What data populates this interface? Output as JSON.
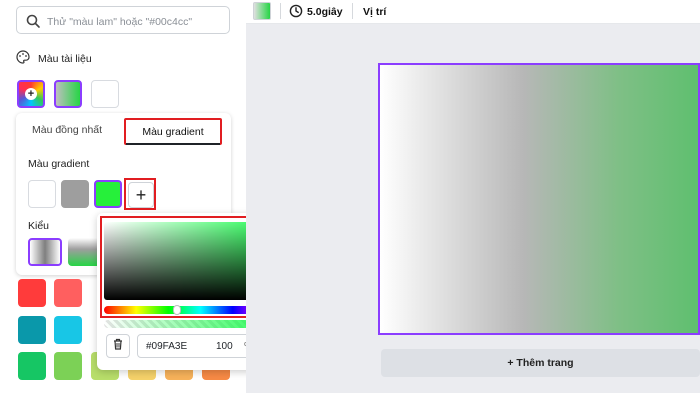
{
  "search": {
    "placeholder": "Thử \"màu lam\" hoặc \"#00c4cc\""
  },
  "document_colors": {
    "label": "Màu tài liệu",
    "add_icon_text": "+"
  },
  "tabs": {
    "solid": "Màu đồng nhất",
    "gradient": "Màu gradient"
  },
  "gradient_section": {
    "label": "Màu gradient",
    "stops": [
      "#ffffff",
      "#9e9e9e",
      "#26f03a"
    ],
    "add_text": "+"
  },
  "style_section": {
    "label": "Kiểu"
  },
  "palette_rows": [
    [
      "#ff3b3b",
      "#ff5f5f",
      "#ff8a8a",
      "#ff8a8a",
      "#ff8a8a",
      "#ff8a8a",
      "#ff8a8a"
    ],
    [
      "#0a98aa",
      "#18c6e6",
      "#31d1ea",
      "#31d1ea",
      "#31d1ea",
      "#31d1ea",
      "#31d1ea"
    ],
    [
      "#16c664",
      "#7cd156",
      "#b8de6a",
      "#f5d26a",
      "#f7b25a",
      "#f78a45",
      "#f78a45"
    ]
  ],
  "picker": {
    "hex": "#09FA3E",
    "opacity": "100",
    "percent": "%"
  },
  "toolbar": {
    "duration": "5.0giây",
    "position": "Vị trí"
  },
  "canvas": {
    "add_page": "+ Thêm trang"
  },
  "colors": {
    "accent": "#8b3dff",
    "highlight": "#e11d21",
    "selected_green": "#09FA3E"
  }
}
